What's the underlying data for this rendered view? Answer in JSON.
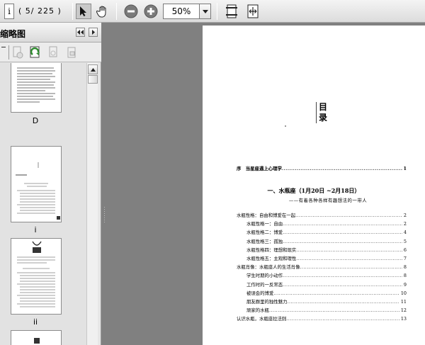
{
  "toolbar": {
    "page_input": "i",
    "page_count": "( 5/ 225 )",
    "zoom": "50%"
  },
  "sidebar": {
    "title": "缩略图",
    "thumbnails": [
      {
        "label": "D"
      },
      {
        "label": "i"
      },
      {
        "label": "ii"
      }
    ]
  },
  "document": {
    "toc_title_chars": [
      "目",
      "录"
    ],
    "preface": {
      "title": "序　当星座遇上心理学",
      "page": "1"
    },
    "chapter_heading": "一、水瓶座（1月20日 ~2月18日）",
    "chapter_subtitle": "——有着各种各样有趣想法的一带人",
    "entries": [
      {
        "text": "水瓶性格：自由和博爱在一起",
        "page": "2",
        "level": 1
      },
      {
        "text": "水瓶性格一：自由",
        "page": "2",
        "level": 2
      },
      {
        "text": "水瓶性格二：博爱",
        "page": "4",
        "level": 2
      },
      {
        "text": "水瓶性格三：孤独",
        "page": "5",
        "level": 2
      },
      {
        "text": "水瓶性格四：理想和现实",
        "page": "6",
        "level": 2
      },
      {
        "text": "水瓶性格五：主观和理性",
        "page": "7",
        "level": 2
      },
      {
        "text": "水瓶肖像：水瓶座人的生活肖像",
        "page": "8",
        "level": 1
      },
      {
        "text": "学生时期的小动作",
        "page": "8",
        "level": 2
      },
      {
        "text": "工作时的一反常态",
        "page": "9",
        "level": 2
      },
      {
        "text": "被误会的博爱",
        "page": "10",
        "level": 2
      },
      {
        "text": "朋友群里的独性魅力",
        "page": "11",
        "level": 2
      },
      {
        "text": "顽家的水瓶",
        "page": "12",
        "level": 2
      },
      {
        "text": "认识水瓶，水瓶座拉法则",
        "page": "13",
        "level": 1
      }
    ]
  }
}
